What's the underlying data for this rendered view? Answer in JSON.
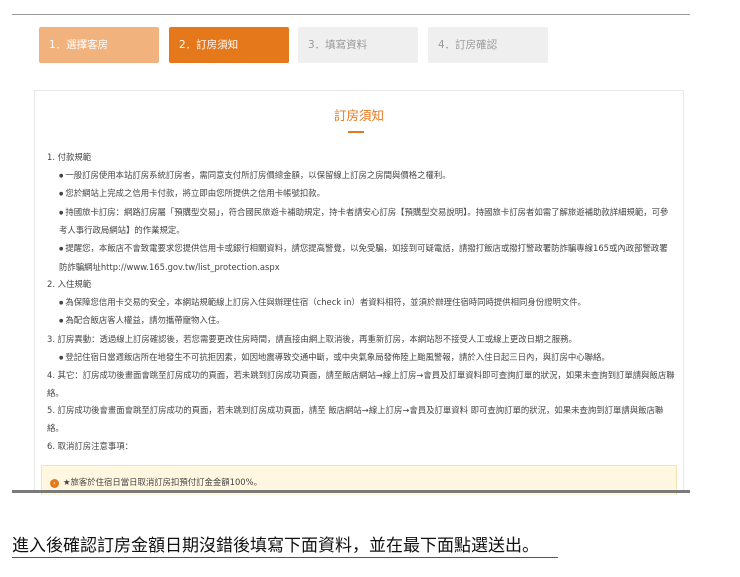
{
  "steps": [
    {
      "label": "1．選擇客房"
    },
    {
      "label": "2．訂房須知"
    },
    {
      "label": "3．填寫資料"
    },
    {
      "label": "4．訂房確認"
    }
  ],
  "card": {
    "title": "訂房須知",
    "lines": [
      "1. 付款規範",
      "一般訂房使用本站訂房系統訂房者，需同意支付所訂房價總金額，以保留線上訂房之房間與價格之權利。",
      "您於網站上完成之信用卡付款，將立即由您所提供之信用卡帳號扣款。",
      "持國旅卡訂房：網路訂房屬「預購型交易」，符合國民旅遊卡補助規定，持卡者請安心訂房【預購型交易說明】。持國旅卡訂房者如需了解旅遊補助款詳細規範，可參考人事行政局網站】的作業規定。",
      "提醒您，本飯店不會致電要求您提供信用卡或銀行相關資料，請您提高警覺，以免受騙，如接到可疑電話，請撥打飯店或撥打警政署防詐騙專線165或內政部警政署防詐騙網址http://www.165.gov.tw/list_protection.aspx",
      "2. 入住規範",
      "為保障您信用卡交易的安全，本網站規範線上訂房入住與辦理住宿（check in）者資料相符，並須於辦理住宿時同時提供相同身份證明文件。",
      "為配合飯店客人權益，請勿攜帶寵物入住。",
      "3. 訂房異動：透過線上訂房確認後，若您需要更改住房時間，請直接由網上取消後，再重新訂房，本網站恕不接受人工或線上更改日期之服務。",
      "登記住宿日當週飯店所在地發生不可抗拒因素，如因地震導致交通中斷，或中央氣象局發佈陸上颱風警報，請於入住日起三日內，與訂房中心聯絡。",
      "4. 其它：訂房成功後畫面會跳至訂房成功的頁面，若未跳到訂房成功頁面，請至飯店網站→線上訂房→會員及訂單資料即可查詢訂單的狀況，如果未查詢到訂單請與飯店聯絡。",
      "5. 訂房成功後會畫面會跳至訂房成功的頁面，若未跳到訂房成功頁面，請至 飯店網站→線上訂房→會員及訂單資料 即可查詢訂單的狀況，如果未查詢到訂單請與飯店聯絡。",
      "6. 取消訂房注意事項："
    ],
    "notice": "★旅客於住宿日當日取消訂房扣預付訂金金額100%。"
  },
  "caption": "進入後確認訂房金額日期沒錯後填寫下面資料，並在最下面點選送出。",
  "colors": {
    "accent": "#e6781c",
    "accent_light": "#f2b27e",
    "inactive": "#efefef"
  }
}
